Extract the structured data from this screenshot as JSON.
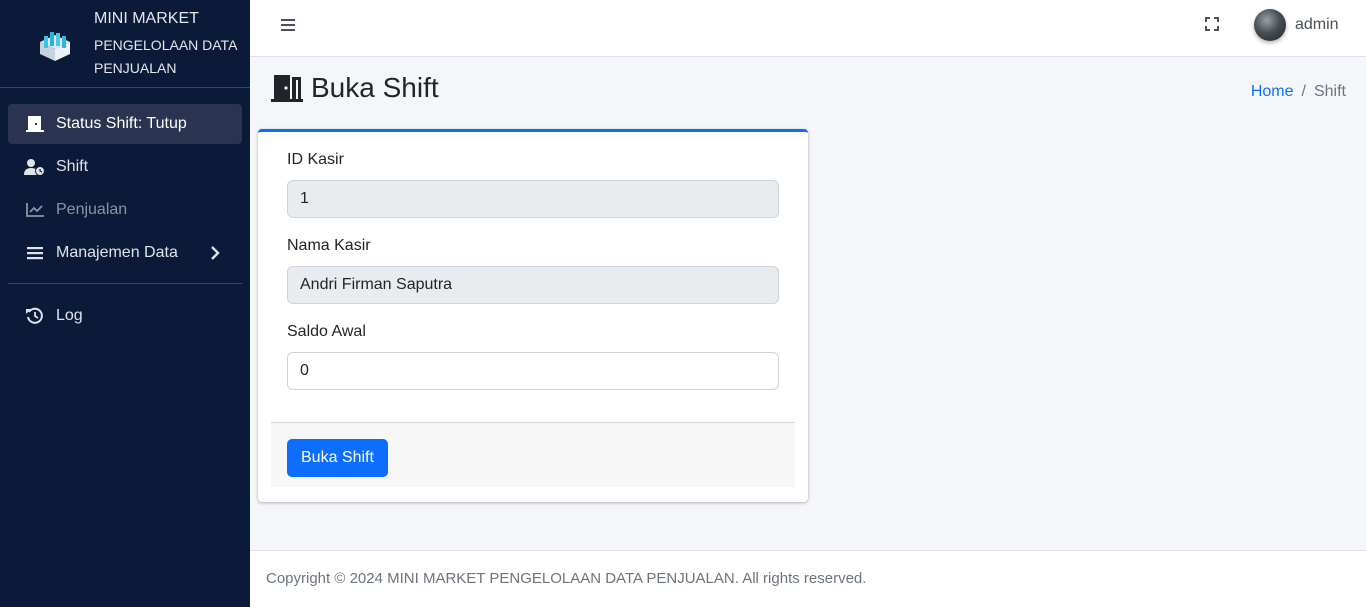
{
  "sidebar": {
    "brand_title": "MINI MARKET",
    "brand_subtitle": "PENGELOLAAN DATA PENJUALAN",
    "items": [
      {
        "label": "Status Shift: Tutup",
        "icon": "door-icon",
        "active": true
      },
      {
        "label": "Shift",
        "icon": "user-clock-icon"
      },
      {
        "label": "Penjualan",
        "icon": "chart-line-icon",
        "muted": true
      },
      {
        "label": "Manajemen Data",
        "icon": "bars-icon",
        "has_submenu": true
      },
      {
        "label": "Log",
        "icon": "history-icon"
      }
    ]
  },
  "topbar": {
    "username": "admin"
  },
  "page": {
    "title": "Buka Shift",
    "breadcrumb": {
      "home": "Home",
      "separator": "/",
      "current": "Shift"
    }
  },
  "form": {
    "id_kasir_label": "ID Kasir",
    "id_kasir_value": "1",
    "nama_kasir_label": "Nama Kasir",
    "nama_kasir_value": "Andri Firman Saputra",
    "saldo_awal_label": "Saldo Awal",
    "saldo_awal_value": "0",
    "submit_label": "Buka Shift"
  },
  "footer": {
    "text": "Copyright © 2024 MINI MARKET PENGELOLAAN DATA PENJUALAN. All rights reserved."
  },
  "colors": {
    "sidebar_bg": "#0b1a38",
    "primary": "#0d6efd"
  }
}
